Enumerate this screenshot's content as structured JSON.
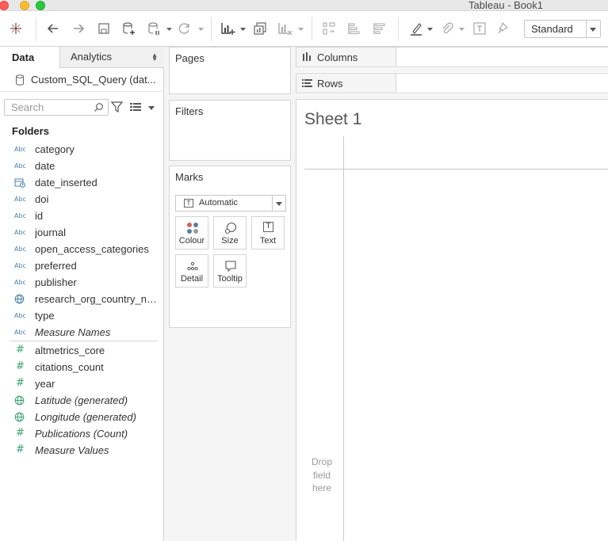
{
  "window": {
    "title": "Tableau - Book1"
  },
  "toolbar": {
    "icons": [
      "tableau-logo-icon",
      "undo-icon",
      "redo-icon",
      "save-icon",
      "new-datasource-icon",
      "pause-updates-icon",
      "refresh-icon",
      "new-worksheet-icon",
      "duplicate-sheet-icon",
      "clear-sheet-icon",
      "swap-icon",
      "sort-ascending-icon",
      "sort-descending-icon",
      "highlight-icon",
      "attach-icon",
      "text-label-icon",
      "pin-icon"
    ],
    "fit_select": "Standard"
  },
  "left_pane": {
    "tabs": {
      "data": "Data",
      "analytics": "Analytics"
    },
    "datasource": "Custom_SQL_Query (dat...",
    "search_placeholder": "Search",
    "folders_title": "Folders",
    "dimensions": [
      {
        "name": "category",
        "type": "string"
      },
      {
        "name": "date",
        "type": "string"
      },
      {
        "name": "date_inserted",
        "type": "datetime"
      },
      {
        "name": "doi",
        "type": "string"
      },
      {
        "name": "id",
        "type": "string"
      },
      {
        "name": "journal",
        "type": "string"
      },
      {
        "name": "open_access_categories",
        "type": "string"
      },
      {
        "name": "preferred",
        "type": "string"
      },
      {
        "name": "publisher",
        "type": "string"
      },
      {
        "name": "research_org_country_na...",
        "type": "geo"
      },
      {
        "name": "type",
        "type": "string"
      },
      {
        "name": "Measure Names",
        "type": "string",
        "italic": true
      }
    ],
    "measures": [
      {
        "name": "altmetrics_core",
        "type": "number"
      },
      {
        "name": "citations_count",
        "type": "number"
      },
      {
        "name": "year",
        "type": "number"
      },
      {
        "name": "Latitude (generated)",
        "type": "geo",
        "italic": true
      },
      {
        "name": "Longitude (generated)",
        "type": "geo",
        "italic": true
      },
      {
        "name": "Publications (Count)",
        "type": "number",
        "italic": true
      },
      {
        "name": "Measure Values",
        "type": "number",
        "italic": true
      }
    ],
    "type_icon_text": {
      "string": "Abc",
      "number": "#"
    }
  },
  "cards": {
    "pages": "Pages",
    "filters": "Filters",
    "marks": {
      "title": "Marks",
      "type": "Automatic",
      "type_icon_text": "T",
      "buttons": {
        "colour": "Colour",
        "size": "Size",
        "text": "Text",
        "detail": "Detail",
        "tooltip": "Tooltip"
      },
      "text_icon_text": "T"
    }
  },
  "shelves": {
    "columns": "Columns",
    "rows": "Rows"
  },
  "view": {
    "sheet_title": "Sheet 1",
    "drop_hint": [
      "Drop",
      "field",
      "here"
    ]
  },
  "colors": {
    "string_icon": "#4a7fa8",
    "number_icon": "#3aa373",
    "pane_bg": "#f5f5f5",
    "border": "#d4d4d4"
  }
}
